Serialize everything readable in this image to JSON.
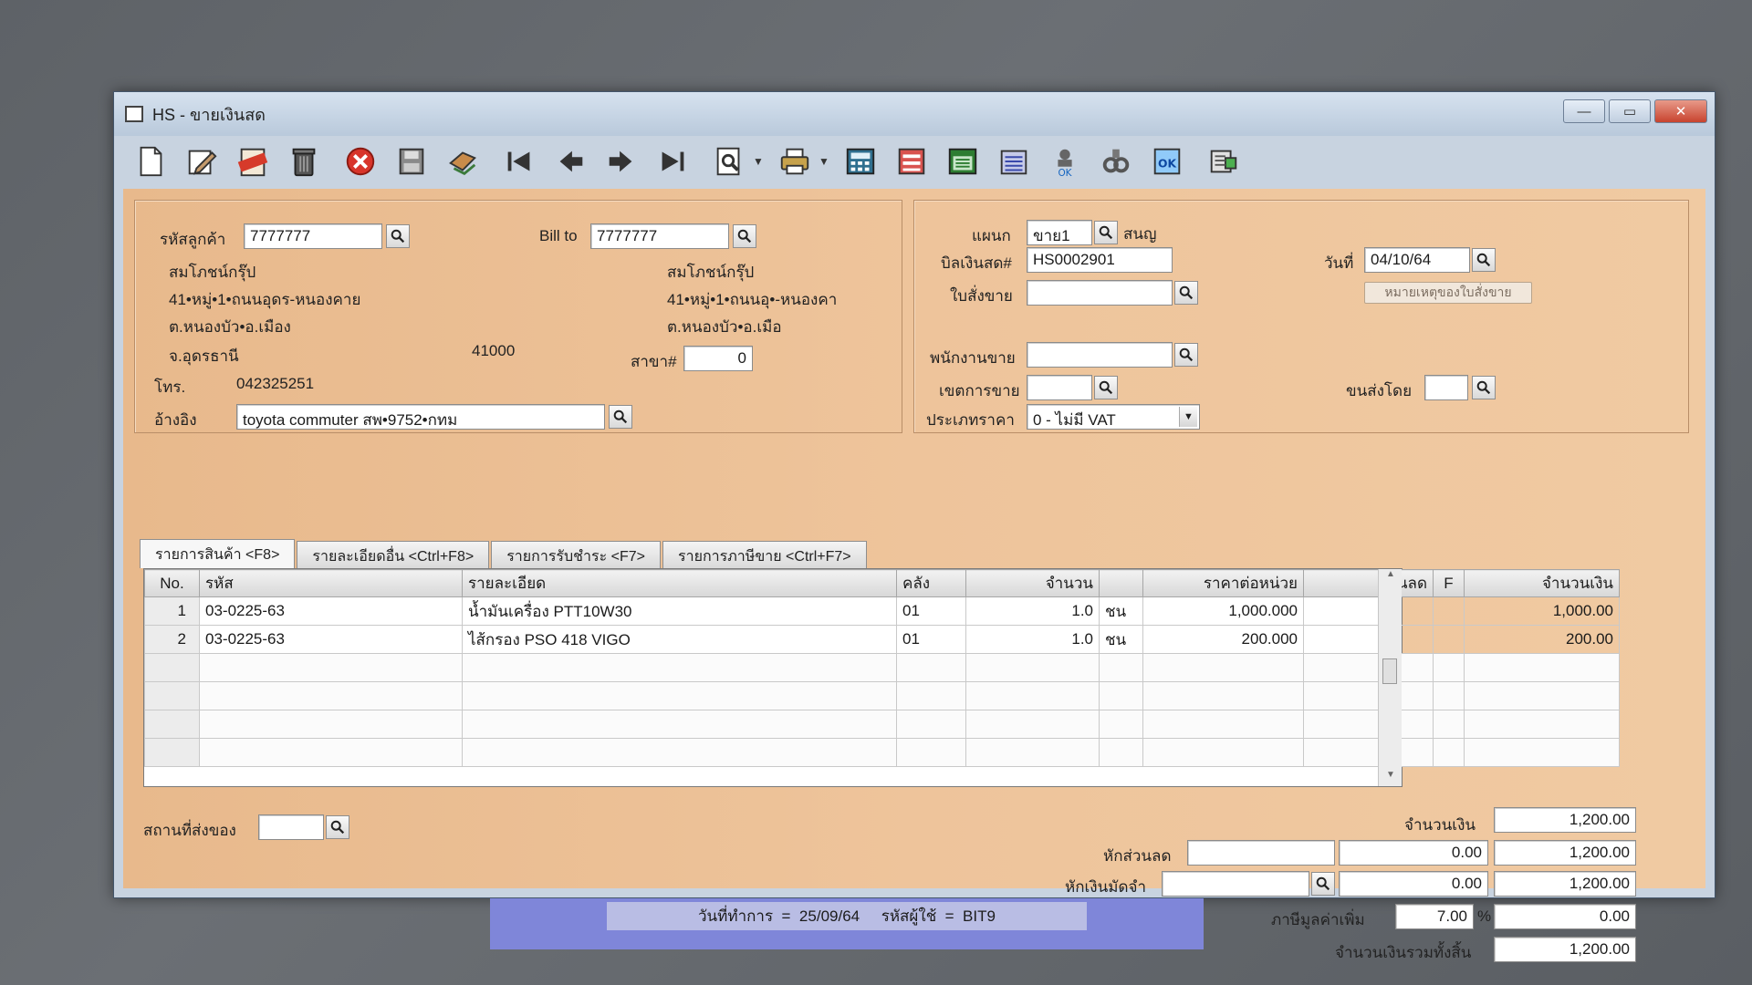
{
  "window": {
    "title": "HS - ขายเงินสด",
    "buttons": {
      "minimize": "—",
      "maximize": "▭",
      "close": "✕"
    }
  },
  "toolbar": {
    "icons": [
      "new-document-icon",
      "edit-icon",
      "void-icon",
      "delete-trash-icon",
      "cancel-icon",
      "save-icon",
      "transfer-icon",
      "first-record-icon",
      "previous-record-icon",
      "next-record-icon",
      "last-record-icon",
      "preview-icon",
      "print-icon",
      "calculator-icon",
      "form-icon",
      "schedule-icon",
      "report-icon",
      "approve-icon",
      "link-icon",
      "confirm-ok-icon",
      "network-icon"
    ]
  },
  "customer": {
    "code_label": "รหัสลูกค้า",
    "code": "7777777",
    "bill_to_label": "Bill to",
    "bill_to": "7777777",
    "name": "สมโภชน์กรุ๊ป",
    "address1": "41•หมู่•1•ถนนอุดร-หนองคาย",
    "address2": "ต.หนองบัว•อ.เมือง",
    "province": "จ.อุดรธานี",
    "postcode": "41000",
    "bill_name": "สมโภชน์กรุ๊ป",
    "bill_address1": "41•หมู่•1•ถนนอุ•-หนองคา",
    "bill_address2": "ต.หนองบัว•อ.เมือ",
    "branch_label": "สาขา#",
    "branch": "0",
    "phone_label": "โทร.",
    "phone": "042325251",
    "reference_label": "อ้างอิง",
    "reference": "toyota commuter สพ•9752•กทม"
  },
  "document": {
    "department_label": "แผนก",
    "department": "ขาย1",
    "department_name": "สนญ",
    "bill_no_label": "บิลเงินสด#",
    "bill_no": "HS0002901",
    "date_label": "วันที่",
    "date": "04/10/64",
    "order_label": "ใบสั่งขาย",
    "order": "",
    "order_note_button": "หมายเหตุของใบสั่งขาย",
    "salesperson_label": "พนักงานขาย",
    "salesperson": "",
    "area_label": "เขตการขาย",
    "area": "",
    "shipper_label": "ขนส่งโดย",
    "shipper": "",
    "price_type_label": "ประเภทราคา",
    "price_type": "0 - ไม่มี VAT"
  },
  "tabs": [
    "รายการสินค้า <F8>",
    "รายละเอียดอื่น <Ctrl+F8>",
    "รายการรับชำระ <F7>",
    "รายการภาษีขาย <Ctrl+F7>"
  ],
  "grid": {
    "columns": [
      "No.",
      "รหัส",
      "รายละเอียด",
      "คลัง",
      "จำนวน",
      "",
      "ราคาต่อหน่วย",
      "ส่วนลด",
      "F",
      "จำนวนเงิน"
    ],
    "rows": [
      {
        "no": "1",
        "code": "03-0225-63",
        "desc": "น้ำมันเครื่อง PTT10W30",
        "wh": "01",
        "qty": "1.0",
        "unit": "ชน",
        "price": "1,000.000",
        "disc": "",
        "f": "",
        "amount": "1,000.00"
      },
      {
        "no": "2",
        "code": "03-0225-63",
        "desc": "ไส้กรอง PSO 418 VIGO",
        "wh": "01",
        "qty": "1.0",
        "unit": "ชน",
        "price": "200.000",
        "disc": "",
        "f": "",
        "amount": "200.00"
      }
    ]
  },
  "footer": {
    "delivery_label": "สถานที่ส่งของ",
    "delivery": "",
    "amount_label": "จำนวนเงิน",
    "amount": "1,200.00",
    "discount_label": "หักส่วนลด",
    "discount_text": "",
    "discount": "0.00",
    "after_discount": "1,200.00",
    "deposit_label": "หักเงินมัดจำ",
    "deposit_text": "",
    "deposit": "0.00",
    "after_deposit": "1,200.00",
    "vat_label": "ภาษีมูลค่าเพิ่ม",
    "vat_rate": "7.00",
    "vat_percent": "%",
    "vat_amount": "0.00",
    "total_label": "จำนวนเงินรวมทั้งสิ้น",
    "total": "1,200.00"
  },
  "status": {
    "text": "วันที่ทำการ  =  25/09/64     รหัสผู้ใช้  =  BIT9"
  }
}
